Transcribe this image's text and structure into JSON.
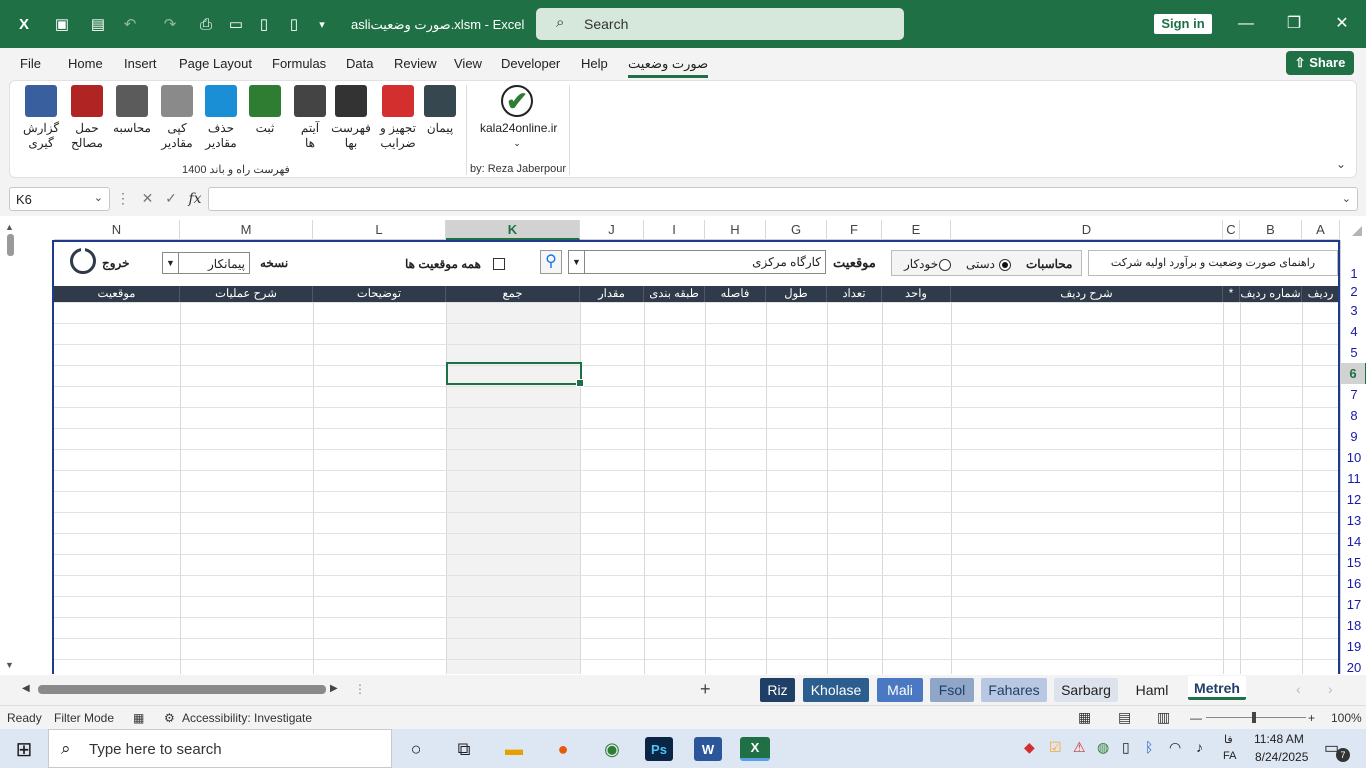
{
  "titlebar": {
    "title": "asliصورت وضعیت.xlsm  -  Excel",
    "search_placeholder": "Search",
    "sign_in": "Sign in"
  },
  "menu": {
    "items": [
      "File",
      "Home",
      "Insert",
      "Page Layout",
      "Formulas",
      "Data",
      "Review",
      "View",
      "Developer",
      "Help",
      "صورت وضعیت"
    ],
    "share": "Share"
  },
  "ribbon": {
    "buttons": [
      {
        "line1": "گزارش",
        "line2": "گیری",
        "icon": "printer-icon",
        "color": "#3a5f9e"
      },
      {
        "line1": "حمل",
        "line2": "مصالح",
        "icon": "truck-icon",
        "color": "#b02424"
      },
      {
        "line1": "محاسبه",
        "line2": "",
        "icon": "calculator-icon",
        "color": "#5b5b5b"
      },
      {
        "line1": "کپی",
        "line2": "مقادیر",
        "icon": "copy-icon",
        "color": "#8a8a8a"
      },
      {
        "line1": "حذف",
        "line2": "مقادیر",
        "icon": "eraser-icon",
        "color": "#1a8fd6"
      },
      {
        "line1": "ثبت",
        "line2": "",
        "icon": "save-book-icon",
        "color": "#2e7d32"
      },
      {
        "line1": "آیتم",
        "line2": "ها",
        "icon": "clipboard-icon",
        "color": "#444444"
      },
      {
        "line1": "فهرست",
        "line2": "بها",
        "icon": "list-icon",
        "color": "#333333"
      },
      {
        "line1": "تجهیز و",
        "line2": "ضرایب",
        "icon": "percent-icon",
        "color": "#d32f2f"
      },
      {
        "line1": "پیمان",
        "line2": "",
        "icon": "handshake-icon",
        "color": "#37474f"
      }
    ],
    "group1_label": "فهرست راه  و باند  1400",
    "site_button": "kala24online.ir",
    "group2_label": "by: Reza Jaberpour"
  },
  "formula": {
    "name_box": "K6",
    "fx": "fx",
    "value": ""
  },
  "grid": {
    "columns": [
      "N",
      "M",
      "L",
      "K",
      "J",
      "I",
      "H",
      "G",
      "F",
      "E",
      "D",
      "C",
      "B",
      "A"
    ],
    "rows": [
      "1",
      "2",
      "3",
      "4",
      "5",
      "6",
      "7",
      "8",
      "9",
      "10",
      "11",
      "12",
      "13",
      "14",
      "15",
      "16",
      "17",
      "18",
      "19",
      "20"
    ],
    "active_col": "K",
    "active_row": "6"
  },
  "panel": {
    "exit_label": "خروج",
    "version_value": "پیمانکار",
    "version_label": "نسخه",
    "all_locations_label": "همه موقعیت ها",
    "location_value": "کارگاه مرکزی",
    "location_label": "موقعیت",
    "calc_auto": "خودکار",
    "calc_manual": "دستی",
    "calc_label": "محاسبات",
    "guide": "راهنمای صورت وضعیت و برآورد اولیه شرکت"
  },
  "table_headers": [
    "موقعیت",
    "شرح عملیات",
    "توضیحات",
    "جمع",
    "مقدار",
    "طبقه بندی",
    "فاصله",
    "طول",
    "تعداد",
    "واحد",
    "شرح ردیف",
    "*",
    "شماره ردیف",
    "ردیف"
  ],
  "sheet_tabs": [
    {
      "label": "Riz",
      "bg": "#1f3f66",
      "fg": "#ffffff"
    },
    {
      "label": "Kholase",
      "bg": "#2b5d8f",
      "fg": "#ffffff"
    },
    {
      "label": "Mali",
      "bg": "#4a78c2",
      "fg": "#ffffff"
    },
    {
      "label": "Fsol",
      "bg": "#8fa6c9",
      "fg": "#1f3f66"
    },
    {
      "label": "Fahares",
      "bg": "#b8c8e2",
      "fg": "#1f3f66"
    },
    {
      "label": "Sarbarg",
      "bg": "#dde3ec",
      "fg": "#222222"
    },
    {
      "label": "Haml",
      "bg": "#f3f3f3",
      "fg": "#222222"
    },
    {
      "label": "Metreh",
      "bg": "#ffffff",
      "fg": "#1f3f66"
    }
  ],
  "status": {
    "ready": "Ready",
    "mode": "Filter Mode",
    "accessibility": "Accessibility: Investigate",
    "zoom": "100%"
  },
  "taskbar": {
    "search_placeholder": "Type here to search",
    "lang1": "فا",
    "lang2": "FA",
    "time": "11:48 AM",
    "date": "8/24/2025",
    "notif_count": "7"
  }
}
